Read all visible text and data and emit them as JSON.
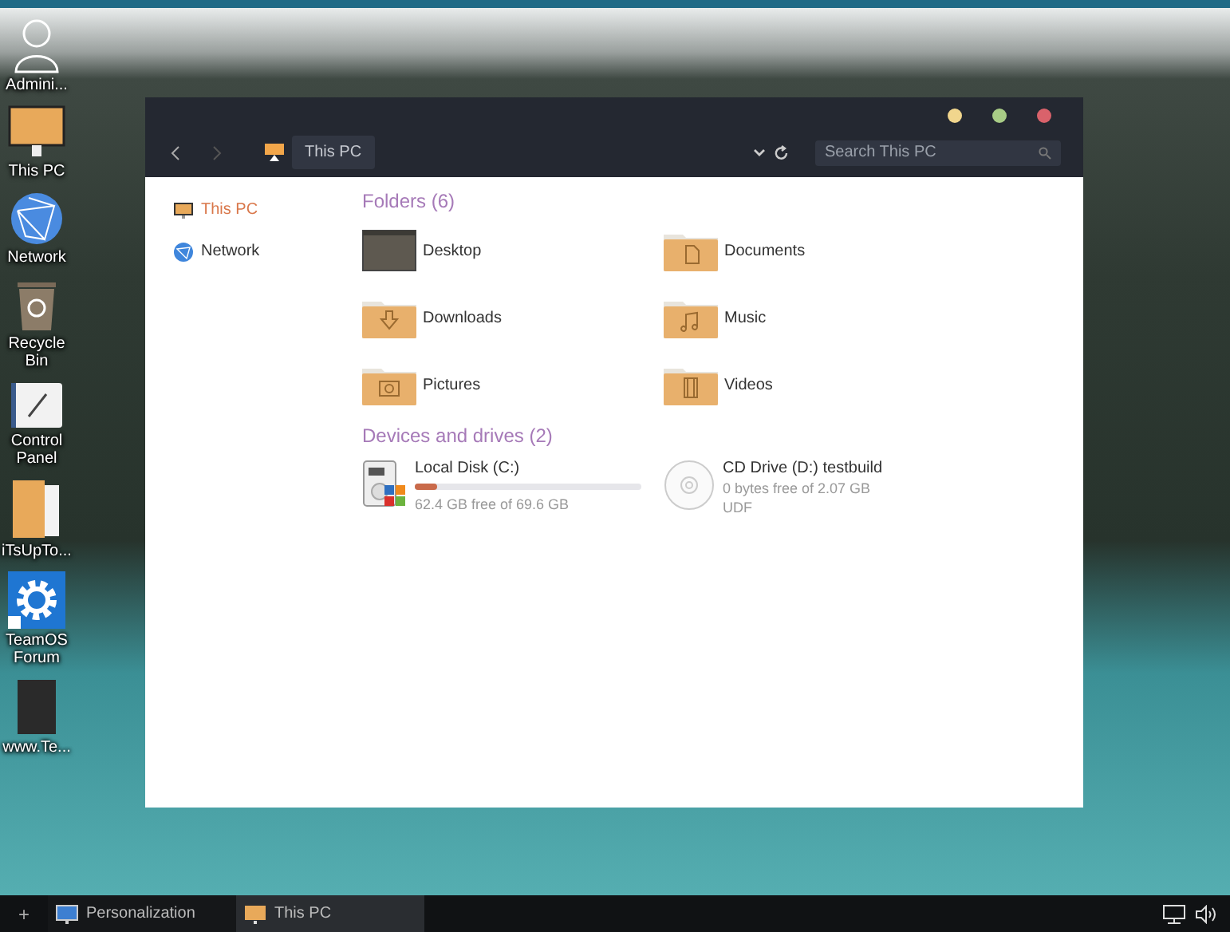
{
  "desktop_icons": [
    {
      "label": "Admini...",
      "kind": "user"
    },
    {
      "label": "This PC",
      "kind": "pc"
    },
    {
      "label": "Network",
      "kind": "network"
    },
    {
      "label": "Recycle Bin",
      "kind": "bin"
    },
    {
      "label": "Control Panel",
      "kind": "control"
    },
    {
      "label": "iTsUpTo...",
      "kind": "folder"
    },
    {
      "label": "TeamOS Forum",
      "kind": "gear"
    },
    {
      "label": "www.Te...",
      "kind": "file"
    }
  ],
  "window": {
    "location": "This PC",
    "search": {
      "placeholder": "Search This PC"
    },
    "sidebar": {
      "items": [
        {
          "label": "This PC",
          "kind": "pc",
          "selected": true
        },
        {
          "label": "Network",
          "kind": "network",
          "selected": false
        }
      ]
    },
    "folders_heading": "Folders (6)",
    "folders": [
      {
        "label": "Desktop",
        "kind": "desktop"
      },
      {
        "label": "Documents",
        "kind": "document"
      },
      {
        "label": "Downloads",
        "kind": "download"
      },
      {
        "label": "Music",
        "kind": "music"
      },
      {
        "label": "Pictures",
        "kind": "camera"
      },
      {
        "label": "Videos",
        "kind": "film"
      }
    ],
    "drives_heading": "Devices and drives (2)",
    "drives": [
      {
        "name": "Local Disk (C:)",
        "kind": "disk",
        "level": 0.1,
        "detail": "62.4 GB free of 69.6 GB"
      },
      {
        "name": "CD Drive (D:) testbuild",
        "kind": "cd",
        "detail": "0 bytes free of 2.07 GB",
        "filesystem": "UDF"
      }
    ]
  },
  "taskbar": {
    "start": "+",
    "tasks": [
      {
        "label": "Personalization",
        "kind": "personalize"
      },
      {
        "label": "This PC",
        "kind": "pc"
      }
    ]
  }
}
